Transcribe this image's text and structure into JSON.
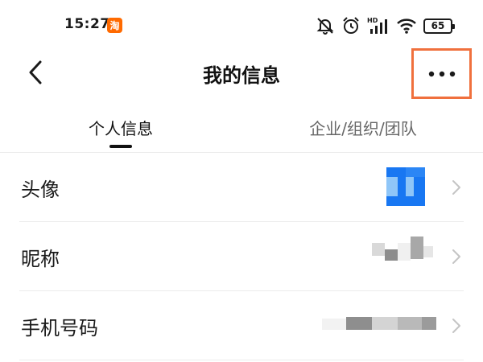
{
  "status_bar": {
    "time": "15:27",
    "app_badge": "淘",
    "battery": "65",
    "icons": [
      "mute-icon",
      "alarm-icon",
      "hd-signal-icon",
      "wifi-icon",
      "battery-icon"
    ]
  },
  "header": {
    "title": "我的信息",
    "back_icon": "chevron-left-icon",
    "more_icon": "more-dots-icon"
  },
  "tabs": [
    {
      "label": "个人信息",
      "active": true
    },
    {
      "label": "企业/组织/团队",
      "active": false
    }
  ],
  "rows": [
    {
      "label": "头像",
      "value_type": "avatar"
    },
    {
      "label": "昵称",
      "value_type": "text"
    },
    {
      "label": "手机号码",
      "value_type": "text"
    }
  ],
  "colors": {
    "highlight": "#f0703d",
    "avatar": "#1877f2",
    "divider": "#ececec"
  }
}
